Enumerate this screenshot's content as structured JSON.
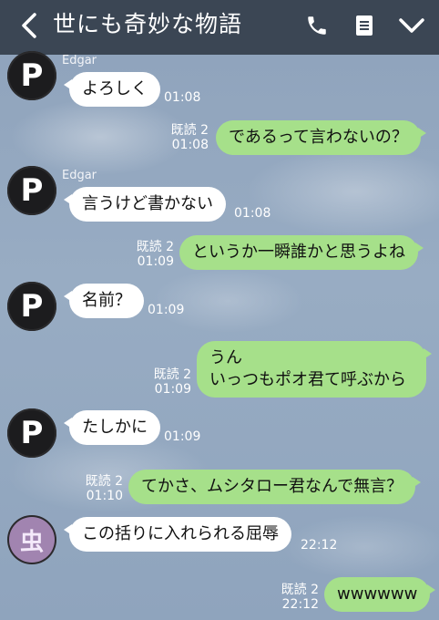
{
  "header": {
    "title": "世にも奇妙な物語",
    "back_icon": "chevron-left-icon",
    "call_icon": "phone-icon",
    "notes_icon": "notes-icon",
    "menu_icon": "chevron-down-icon",
    "bg_color": "#3b4654"
  },
  "colors": {
    "incoming_bubble": "#ffffff",
    "outgoing_bubble": "#a6e08a"
  },
  "messages": [
    {
      "side": "in",
      "sender": "Edgar",
      "avatar": "P",
      "text": "よろしく",
      "time": "01:08"
    },
    {
      "side": "out",
      "read": "既読 2",
      "text": "であるって言わないの？",
      "time": "01:08"
    },
    {
      "side": "in",
      "sender": "Edgar",
      "avatar": "P",
      "text": "言うけど書かない",
      "time": "01:08"
    },
    {
      "side": "out",
      "read": "既読 2",
      "text": "というか一瞬誰かと思うよね",
      "time": "01:09"
    },
    {
      "side": "in",
      "avatar": "P",
      "text": "名前？",
      "time": "01:09"
    },
    {
      "side": "out",
      "read": "既読 2",
      "line1": "うん",
      "line2": "いっつもポオ君て呼ぶから",
      "time": "01:09"
    },
    {
      "side": "in",
      "avatar": "P",
      "text": "たしかに",
      "time": "01:09"
    },
    {
      "side": "out",
      "read": "既読 2",
      "text": "てかさ、ムシタロー君なんで無言？",
      "time": "01:10"
    },
    {
      "side": "in",
      "avatar": "虫",
      "text": "この括りに入れられる屈辱",
      "time": "22:12"
    },
    {
      "side": "out",
      "read": "既読 2",
      "text": "wwwwww",
      "time": "22:12"
    }
  ]
}
